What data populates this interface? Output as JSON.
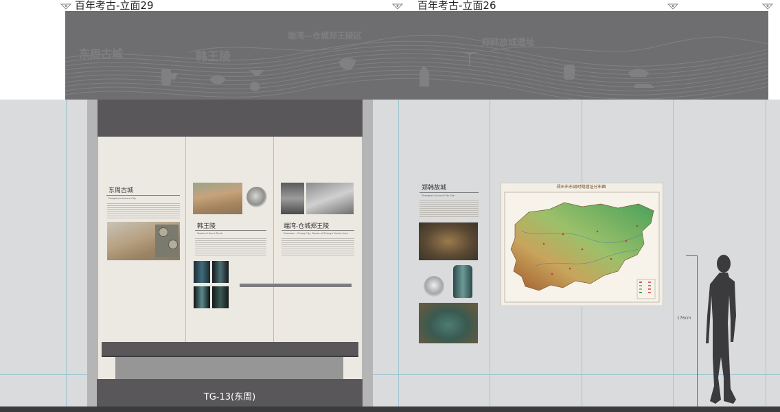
{
  "elevation_labels": {
    "left": "百年考古-立面29",
    "right": "百年考古-立面26"
  },
  "banner": {
    "text_east_zhou_city": "东周古城",
    "text_han_king_tomb": "韩王陵",
    "text_xuwan": "端湾—仓城郑王陵区",
    "text_zhenghan": "郑韩故城遗址"
  },
  "case": {
    "label": "TG-13(东周)",
    "panel_1": {
      "title": "东周古城",
      "subtitle": "Dongzhou Ancient City"
    },
    "panel_2": {
      "title": "韩王陵",
      "subtitle": "Tombs of Han's Tomb"
    },
    "panel_3": {
      "title": "端湾-仓城郑王陵",
      "subtitle": "Duanwan - Chang City, Tombs of Zheng's Family Area"
    }
  },
  "wall_panel": {
    "title": "郑韩故城",
    "subtitle": "Zhenghan Ancient City Site"
  },
  "map": {
    "title": "郑州市东周时期遗址分布图"
  },
  "dimension": {
    "height_label": "176cm"
  },
  "colors": {
    "banner": "#6e6d6f",
    "wall": "#d9dbdc",
    "case_dark": "#59575a",
    "board": "#ece9e2",
    "guide_line": "#9fc6d3"
  }
}
